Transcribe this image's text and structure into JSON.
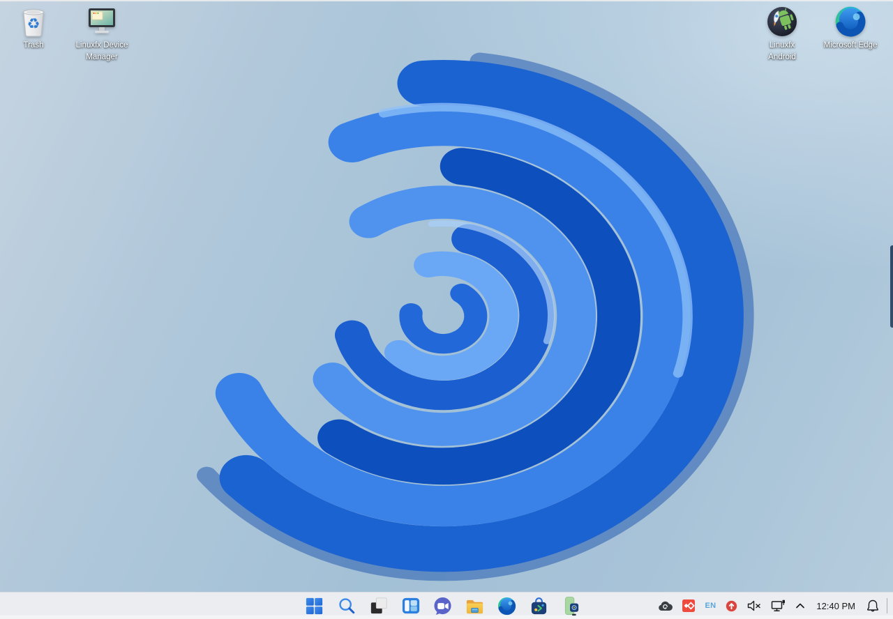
{
  "desktop": {
    "icons": [
      {
        "id": "trash",
        "label": "Trash",
        "lines": [
          "Trash"
        ]
      },
      {
        "id": "linuxfx-device-manager",
        "label": "Linuxfx Device Manager",
        "lines": [
          "Linuxfx Device",
          "Manager"
        ]
      },
      {
        "id": "linuxfx-android",
        "label": "Linuxfx Android",
        "lines": [
          "Linuxfx",
          "Android"
        ]
      },
      {
        "id": "microsoft-edge",
        "label": "Microsoft Edge",
        "lines": [
          "Microsoft Edge"
        ]
      }
    ]
  },
  "taskbar": {
    "app_icons": [
      {
        "id": "start",
        "icon": "windows-start-icon"
      },
      {
        "id": "search",
        "icon": "search-icon"
      },
      {
        "id": "task-view",
        "icon": "task-view-squares-icon"
      },
      {
        "id": "window-layout",
        "icon": "window-panes-icon"
      },
      {
        "id": "video-chat",
        "icon": "video-chat-bubble-icon"
      },
      {
        "id": "file-manager",
        "icon": "folder-icon"
      },
      {
        "id": "edge-browser",
        "icon": "edge-swirl-icon"
      },
      {
        "id": "app-store",
        "icon": "store-bag-icon"
      },
      {
        "id": "android-phone",
        "icon": "green-phone-icon"
      }
    ],
    "tray": {
      "keyboard_layout": "EN",
      "clock": "12:40 PM",
      "icons": [
        "cloud-sync-tray-icon",
        "anydesk-tray-icon",
        "update-notifier-tray-icon",
        "volume-muted-icon",
        "wired-network-icon",
        "chevron-up-icon",
        "notification-bell-icon"
      ]
    }
  },
  "colors": {
    "taskbar_bg": "#ebedf1",
    "accent_blue": "#2f7ee3",
    "desktop_blue": "#a7c3d9",
    "bloom_deep": "#0e4fbe",
    "bloom_mid": "#2268d8",
    "bloom_light": "#6aa7f4",
    "anydesk_red": "#ee4b3e",
    "update_red": "#d8453f",
    "keyboard_text_blue": "#57a6dc",
    "chat_purple": "#5a64c8",
    "folder_yellow": "#f5c64b",
    "store_navy": "#1d3f77",
    "phone_green": "#a9d7a2"
  }
}
